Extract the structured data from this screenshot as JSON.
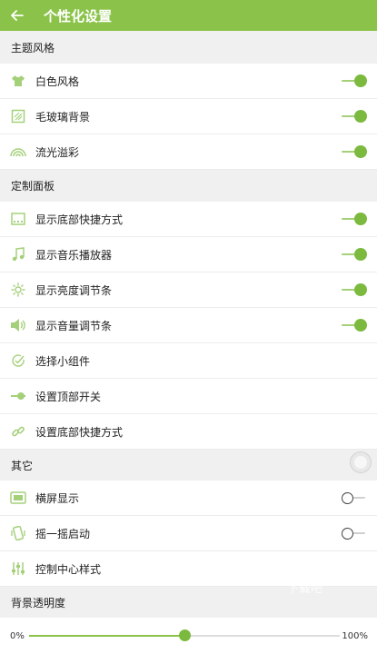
{
  "header": {
    "title": "个性化设置"
  },
  "sections": {
    "theme": {
      "title": "主题风格"
    },
    "panel": {
      "title": "定制面板"
    },
    "other": {
      "title": "其它"
    },
    "opacity": {
      "title": "背景透明度"
    }
  },
  "theme_items": [
    {
      "label": "白色风格",
      "icon": "tshirt-icon",
      "on": true
    },
    {
      "label": "毛玻璃背景",
      "icon": "frosted-glass-icon",
      "on": true
    },
    {
      "label": "流光溢彩",
      "icon": "rainbow-icon",
      "on": true
    }
  ],
  "panel_items": [
    {
      "label": "显示底部快捷方式",
      "icon": "dock-icon",
      "on": true
    },
    {
      "label": "显示音乐播放器",
      "icon": "music-note-icon",
      "on": true
    },
    {
      "label": "显示亮度调节条",
      "icon": "brightness-icon",
      "on": true
    },
    {
      "label": "显示音量调节条",
      "icon": "volume-icon",
      "on": true
    },
    {
      "label": "选择小组件",
      "icon": "check-circle-icon"
    },
    {
      "label": "设置顶部开关",
      "icon": "toggle-slider-icon"
    },
    {
      "label": "设置底部快捷方式",
      "icon": "link-icon"
    }
  ],
  "other_items": [
    {
      "label": "横屏显示",
      "icon": "landscape-icon",
      "on": false
    },
    {
      "label": "摇一摇启动",
      "icon": "shake-phone-icon",
      "on": false
    },
    {
      "label": "控制中心样式",
      "icon": "sliders-icon"
    }
  ],
  "opacity": {
    "min_label": "0%",
    "max_label": "100%",
    "value": 0.5
  },
  "watermark": "下载吧",
  "colors": {
    "accent": "#8bc34a",
    "knob": "#7cba3f",
    "section_bg": "#f0f0f0"
  }
}
